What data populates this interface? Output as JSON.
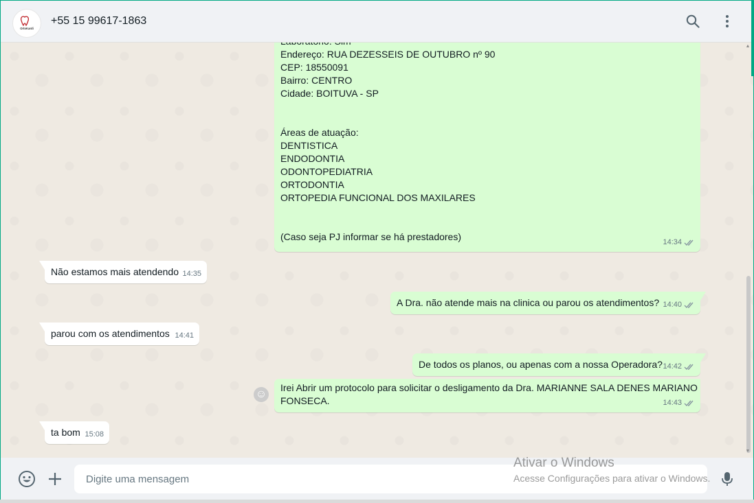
{
  "header": {
    "contact_name": "+55 15 99617-1863",
    "avatar_label": "OrtoKardi",
    "icons": [
      "search-icon",
      "menu-icon"
    ]
  },
  "messages": {
    "m1": {
      "lines": [
        "Laboratório: Sim",
        "Endereço: RUA DEZESSEIS DE OUTUBRO nº 90",
        "CEP: 18550091",
        "Bairro: CENTRO",
        "Cidade: BOITUVA - SP",
        "",
        "",
        "Áreas de atuação:",
        "DENTISTICA",
        "ENDODONTIA",
        "ODONTOPEDIATRIA",
        "ORTODONTIA",
        "ORTOPEDIA FUNCIONAL DOS MAXILARES",
        "",
        "",
        "(Caso seja PJ informar se há prestadores)"
      ],
      "time": "14:34"
    },
    "m2": {
      "text": "Não estamos mais atendendo",
      "time": "14:35"
    },
    "m3": {
      "text": "A Dra. não atende mais na clinica ou parou os atendimentos?",
      "time": "14:40"
    },
    "m4": {
      "text": "parou com os atendimentos",
      "time": "14:41"
    },
    "m5": {
      "text": "De todos os planos, ou apenas com a nossa Operadora?",
      "time": "14:42"
    },
    "m6": {
      "lines": [
        "Irei Abrir um protocolo para solicitar o desligamento da Dra. MARIANNE SALA DENES MARIANO",
        "FONSECA."
      ],
      "time": "14:43"
    },
    "m7": {
      "text": "ta bom",
      "time": "15:08"
    }
  },
  "footer": {
    "placeholder": "Digite uma mensagem",
    "icons": [
      "emoji-icon",
      "attach-plus-icon",
      "microphone-icon"
    ]
  },
  "watermark": {
    "title": "Ativar o Windows",
    "subtitle": "Acesse Configurações para ativar o Windows."
  },
  "colors": {
    "outgoing": "#d9fdd3",
    "incoming": "#ffffff",
    "chat_bg": "#efeae2",
    "header_bg": "#f0f2f5",
    "read_ticks": "#8696a0",
    "accent": "#00a884"
  }
}
